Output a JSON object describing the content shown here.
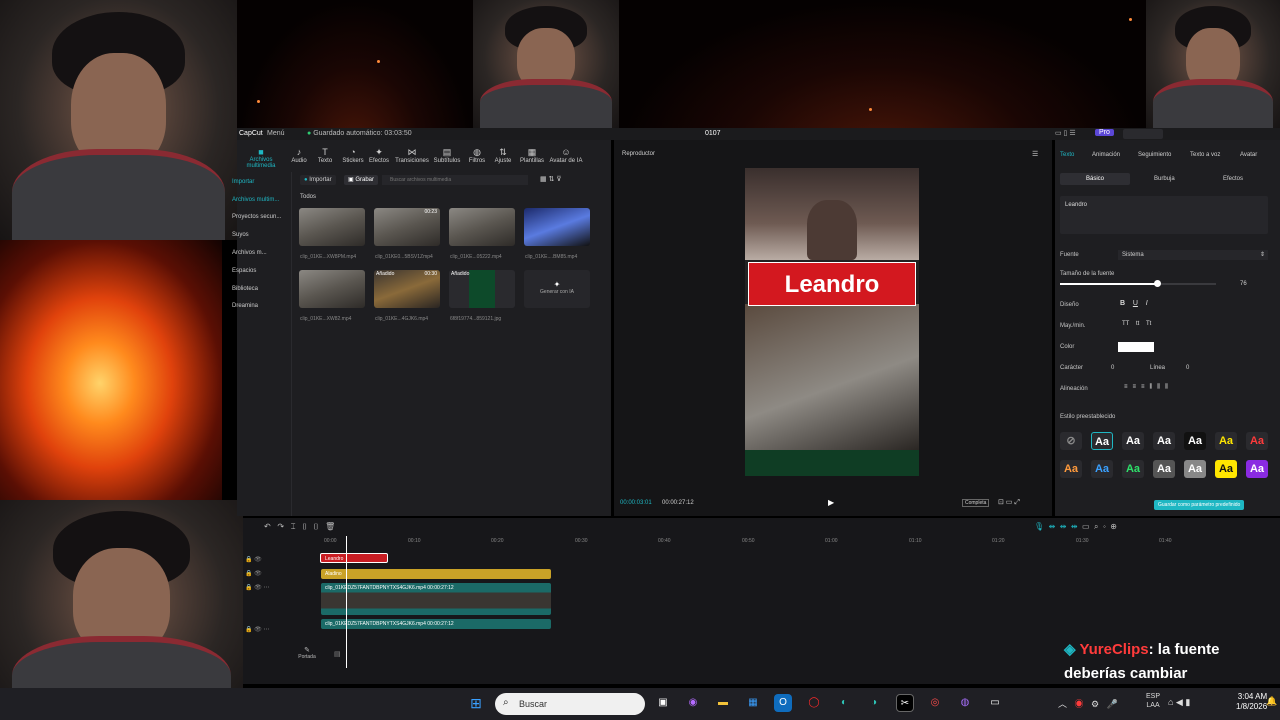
{
  "editor": {
    "logo": "CapCut",
    "menu_label": "Menú",
    "autosave_text": "Guardado automático: 03:03:50",
    "project_title": "0107",
    "pro_badge": "Pro"
  },
  "toolbar": {
    "items": [
      {
        "label": "Audio",
        "icon": "audio-icon"
      },
      {
        "label": "Texto",
        "icon": "text-icon"
      },
      {
        "label": "Stickers",
        "icon": "sticker-icon"
      },
      {
        "label": "Efectos",
        "icon": "effects-icon"
      },
      {
        "label": "Transiciones",
        "icon": "transitions-icon"
      },
      {
        "label": "Subtítulos",
        "icon": "subtitles-icon"
      },
      {
        "label": "Filtros",
        "icon": "filters-icon"
      },
      {
        "label": "Ajuste",
        "icon": "adjust-icon"
      },
      {
        "label": "Plantillas",
        "icon": "templates-icon"
      },
      {
        "label": "Avatar de IA",
        "icon": "ai-avatar-icon"
      }
    ],
    "media_label": "Archivos multimedia"
  },
  "media_nav": {
    "items": [
      "Importar",
      "Archivos multim...",
      "Proyectos secun...",
      "Suyos",
      "Archivos m...",
      "Espacios",
      "Biblioteca",
      "Dreamina"
    ]
  },
  "media_panel": {
    "import_label": "Importar",
    "record_label": "Grabar",
    "search_placeholder": "Buscar archivos multimedia",
    "all_label": "Todos",
    "files": [
      {
        "name": "clip_01KE...XW8PM.mp4",
        "duration": ""
      },
      {
        "name": "clip_01KE0...5BSV1Zmp4",
        "duration": "00:23"
      },
      {
        "name": "clip_01KE...05222.mp4",
        "duration": ""
      },
      {
        "name": "clip_01KE....BM85.mp4",
        "duration": ""
      },
      {
        "name": "clip_01KE...XW82.mp4",
        "duration": ""
      },
      {
        "name": "clip_01KE...4GJK6.mp4",
        "duration": "00:30",
        "badge": "Añadido"
      },
      {
        "name": "6f8f19774...859121.jpg",
        "duration": "",
        "badge": "Añadido"
      }
    ],
    "generate_label": "Generar con IA"
  },
  "player": {
    "title": "Reproductor",
    "overlay_text": "Leandro",
    "current_time": "00:00:03:01",
    "total_time": "00:00:27:12",
    "ratio_label": "Completa"
  },
  "right_panel": {
    "tabs": [
      "Texto",
      "Animación",
      "Seguimiento",
      "Texto a voz",
      "Avatar"
    ],
    "subtabs": [
      "Básico",
      "Burbuja",
      "Efectos"
    ],
    "text_value": "Leandro",
    "font_label": "Fuente",
    "font_value": "Sistema",
    "font_size_label": "Tamaño de la fuente",
    "font_size_value": "76",
    "font_size_fraction": 0.62,
    "design_label": "Diseño",
    "case_label": "May./min.",
    "color_label": "Color",
    "char_label": "Carácter",
    "char_value": "0",
    "line_label": "Línea",
    "line_value": "0",
    "align_label": "Alineación",
    "preset_label": "Estilo preestablecido",
    "save_preset_label": "Guardar como parámetro predefinido",
    "presets": [
      "Aa",
      "Aa",
      "Aa",
      "Aa",
      "Aa",
      "Aa",
      "Aa",
      "Aa",
      "Aa",
      "Aa",
      "Aa",
      "Aa",
      "Aa"
    ]
  },
  "timeline": {
    "ticks": [
      "00:00",
      "00:10",
      "00:20",
      "00:30",
      "00:40",
      "00:50",
      "01:00",
      "01:10",
      "01:20",
      "01:30",
      "01:40"
    ],
    "text_clip": "Leandro",
    "sticker_clip": "Aladino",
    "video_clip_1": "clip_01KEDZ57FANTDBPNYTXS4GJK6.mp4   00:00:27:12",
    "video_clip_2": "clip_01KEDZ57FANTDBPNYTXS4GJK6.mp4   00:00:27:12",
    "cover_label": "Portada"
  },
  "chat": {
    "user": "YureClips",
    "message_line1": ": la fuente",
    "message_line2": "deberías cambiar"
  },
  "taskbar": {
    "search_placeholder": "Buscar",
    "lang_top": "ESP",
    "lang_bottom": "LAA",
    "time": "3:04 AM",
    "date": "1/8/2026"
  },
  "colors": {
    "accent": "#1fb7c3",
    "title_red": "#d3181f",
    "sticker_yellow": "#c9a227",
    "video_teal": "#1b6a67",
    "chat_user": "#ff3b3b"
  }
}
